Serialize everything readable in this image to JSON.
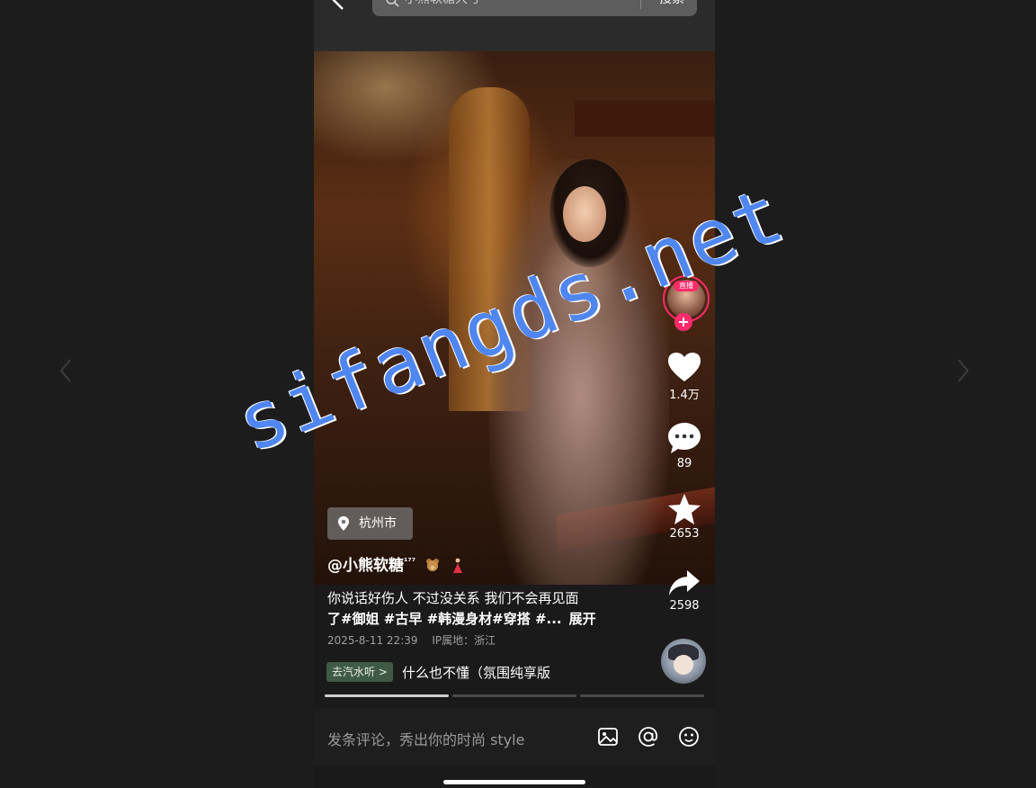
{
  "search": {
    "query": "小熊软糖大号",
    "button_label": "搜索"
  },
  "video": {
    "location": "杭州市",
    "author": "@小熊软糖",
    "author_superscript": "¹⁷⁷",
    "description_line1": "你说话好伤人 不过没关系 我们不会再见面",
    "description_line2": "了#御姐 #古早 #韩漫身材#穿搭 #...",
    "expand_label": "展开",
    "date": "2025-8-11 22:39",
    "ip_location": "IP属地：浙江",
    "music_tag": "去汽水听 >",
    "music_title": "什么也不懂（氛围纯享版",
    "progress_segments": [
      {
        "state": "active"
      },
      {
        "state": "inactive"
      },
      {
        "state": "inactive"
      }
    ]
  },
  "actions": {
    "live_badge": "直播",
    "follow_symbol": "+",
    "like_count": "1.4万",
    "comment_count": "89",
    "favorite_count": "2653",
    "share_count": "2598"
  },
  "comment_bar": {
    "placeholder": "发条评论，秀出你的时尚 style",
    "icons": [
      "image-icon",
      "at-icon",
      "emoji-icon"
    ]
  },
  "watermark": "sifangds.net",
  "colors": {
    "background": "#1c1c1c",
    "accent": "#ff2b6a",
    "watermark": "#4f86f0"
  }
}
